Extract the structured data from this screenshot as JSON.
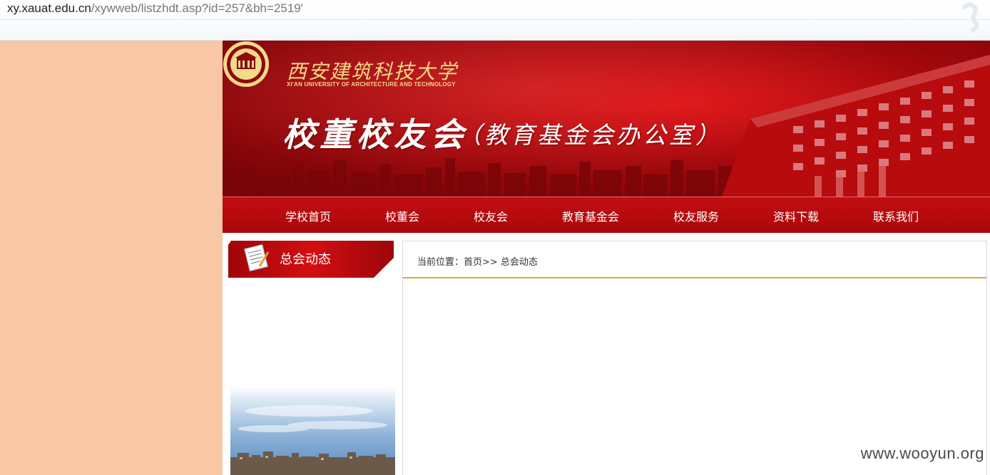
{
  "browser": {
    "url_host": "xy.xauat.edu.cn",
    "url_path": "/xywweb/listzhdt.asp?id=257&bh=2519'"
  },
  "banner": {
    "logo_cn": "西安建筑科技大学",
    "logo_en": "XI'AN UNIVERSITY OF ARCHITECTURE AND TECHNOLOGY",
    "title": "校董校友会",
    "subtitle": "（教育基金会办公室）"
  },
  "nav": {
    "items": [
      {
        "label": "学校首页"
      },
      {
        "label": "校董会"
      },
      {
        "label": "校友会"
      },
      {
        "label": "教育基金会"
      },
      {
        "label": "校友服务"
      },
      {
        "label": "资料下载"
      },
      {
        "label": "联系我们"
      }
    ]
  },
  "sidebar": {
    "title": "总会动态"
  },
  "main": {
    "breadcrumb": "当前位置：首页>> 总会动态"
  },
  "watermark": "www.wooyun.org",
  "colors": {
    "brand_red": "#c30d11",
    "accent_gold": "#e5a42a",
    "left_background": "#f8c8a6"
  }
}
